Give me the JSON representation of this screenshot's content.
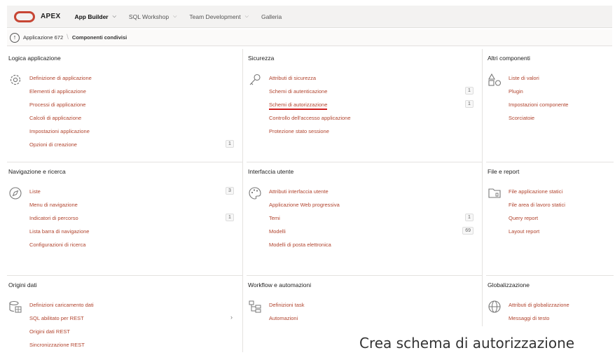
{
  "header": {
    "logo_text": "APEX",
    "nav": [
      {
        "label": "App Builder"
      },
      {
        "label": "SQL Workshop"
      },
      {
        "label": "Team Development"
      },
      {
        "label": "Galleria"
      }
    ]
  },
  "breadcrumb": {
    "parent": "Applicazione 672",
    "current": "Componenti condivisi"
  },
  "panels": [
    {
      "title": "Logica applicazione",
      "icon": "gear-icon",
      "items": [
        {
          "label": "Definizione di applicazione"
        },
        {
          "label": "Elementi di applicazione"
        },
        {
          "label": "Processi di applicazione"
        },
        {
          "label": "Calcoli di applicazione"
        },
        {
          "label": "Impostazioni applicazione"
        },
        {
          "label": "Opzioni di creazione",
          "badge": "1"
        }
      ]
    },
    {
      "title": "Sicurezza",
      "icon": "key-icon",
      "items": [
        {
          "label": "Attributi di sicurezza"
        },
        {
          "label": "Schemi di autenticazione",
          "badge": "1"
        },
        {
          "label": "Schemi di autorizzazione",
          "badge": "1"
        },
        {
          "label": "Controllo dell'accesso applicazione"
        },
        {
          "label": "Protezione stato sessione"
        }
      ]
    },
    {
      "title": "Altri componenti",
      "icon": "shapes-icon",
      "items": [
        {
          "label": "Liste di valori"
        },
        {
          "label": "Plugin"
        },
        {
          "label": "Impostazioni componente"
        },
        {
          "label": "Scorciatoie"
        }
      ]
    },
    {
      "title": "Navigazione e ricerca",
      "icon": "compass-icon",
      "items": [
        {
          "label": "Liste",
          "badge": "3"
        },
        {
          "label": "Menu di navigazione"
        },
        {
          "label": "Indicatori di percorso",
          "badge": "1"
        },
        {
          "label": "Lista barra di navigazione"
        },
        {
          "label": "Configurazioni di ricerca"
        }
      ]
    },
    {
      "title": "Interfaccia utente",
      "icon": "palette-icon",
      "items": [
        {
          "label": "Attributi interfaccia utente"
        },
        {
          "label": "Applicazione Web progressiva"
        },
        {
          "label": "Temi",
          "badge": "1"
        },
        {
          "label": "Modelli",
          "badge": "69"
        },
        {
          "label": "Modelli di posta elettronica"
        }
      ]
    },
    {
      "title": "File e report",
      "icon": "folder-icon",
      "items": [
        {
          "label": "File applicazione statici"
        },
        {
          "label": "File area di lavoro statici"
        },
        {
          "label": "Query report"
        },
        {
          "label": "Layout report"
        }
      ]
    },
    {
      "title": "Origini dati",
      "icon": "database-icon",
      "items": [
        {
          "label": "Definizioni caricamento dati"
        },
        {
          "label": "SQL abilitato per REST",
          "arrow": "›"
        },
        {
          "label": "Origini dati REST"
        },
        {
          "label": "Sincronizzazione REST"
        }
      ]
    },
    {
      "title": "Workflow e automazioni",
      "icon": "workflow-icon",
      "items": [
        {
          "label": "Definizioni task"
        },
        {
          "label": "Automazioni"
        }
      ]
    },
    {
      "title": "Globalizzazione",
      "icon": "globe-icon",
      "items": [
        {
          "label": "Attributi di globalizzazione"
        },
        {
          "label": "Messaggi di testo"
        }
      ]
    }
  ],
  "caption": "Crea schema di autorizzazione",
  "colors": {
    "brand": "#c74634",
    "link": "#b1442e",
    "highlight_underline": "#d11d1d"
  }
}
